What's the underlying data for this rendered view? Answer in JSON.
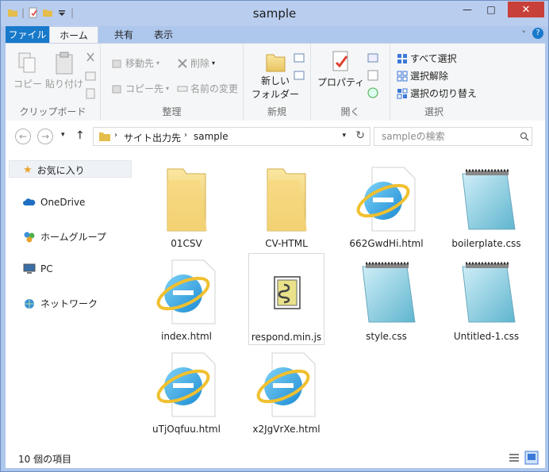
{
  "window": {
    "title": "sample",
    "minimize": "—",
    "maximize": "□",
    "close": "✕"
  },
  "tabs": [
    {
      "label": "ファイル"
    },
    {
      "label": "ホーム"
    },
    {
      "label": "共有"
    },
    {
      "label": "表示"
    }
  ],
  "ribbon": {
    "clipboard": {
      "copy": "コピー",
      "paste": "貼り付け",
      "label": "クリップボード"
    },
    "organize": {
      "move_to": "移動先",
      "copy_to": "コピー先",
      "delete": "削除",
      "rename": "名前の変更",
      "label": "整理"
    },
    "new": {
      "new_folder_line1": "新しい",
      "new_folder_line2": "フォルダー",
      "label": "新規"
    },
    "open": {
      "properties": "プロパティ",
      "label": "開く"
    },
    "select": {
      "select_all": "すべて選択",
      "select_none": "選択解除",
      "invert": "選択の切り替え",
      "label": "選択"
    }
  },
  "address": {
    "crumbs": [
      "サイト出力先",
      "sample"
    ]
  },
  "search": {
    "placeholder": "sampleの検索"
  },
  "sidebar": {
    "items": [
      {
        "label": "お気に入り"
      },
      {
        "label": "OneDrive"
      },
      {
        "label": "ホームグループ"
      },
      {
        "label": "PC"
      },
      {
        "label": "ネットワーク"
      }
    ]
  },
  "files": [
    {
      "name": "01CSV",
      "icon": "folder-icon"
    },
    {
      "name": "CV-HTML",
      "icon": "folder-icon"
    },
    {
      "name": "662GwdHi.html",
      "icon": "ie-html-icon"
    },
    {
      "name": "boilerplate.css",
      "icon": "notepad-css-icon"
    },
    {
      "name": "index.html",
      "icon": "ie-html-icon"
    },
    {
      "name": "respond.min.js",
      "icon": "script-js-icon"
    },
    {
      "name": "style.css",
      "icon": "notepad-css-icon"
    },
    {
      "name": "Untitled-1.css",
      "icon": "notepad-css-icon"
    },
    {
      "name": "uTjOqfuu.html",
      "icon": "ie-html-icon"
    },
    {
      "name": "x2JgVrXe.html",
      "icon": "ie-html-icon"
    }
  ],
  "status": {
    "count": "10 個の項目"
  },
  "colors": {
    "accent": "#1979ca",
    "close": "#c7403a",
    "title_bg": "#b9cdef"
  }
}
